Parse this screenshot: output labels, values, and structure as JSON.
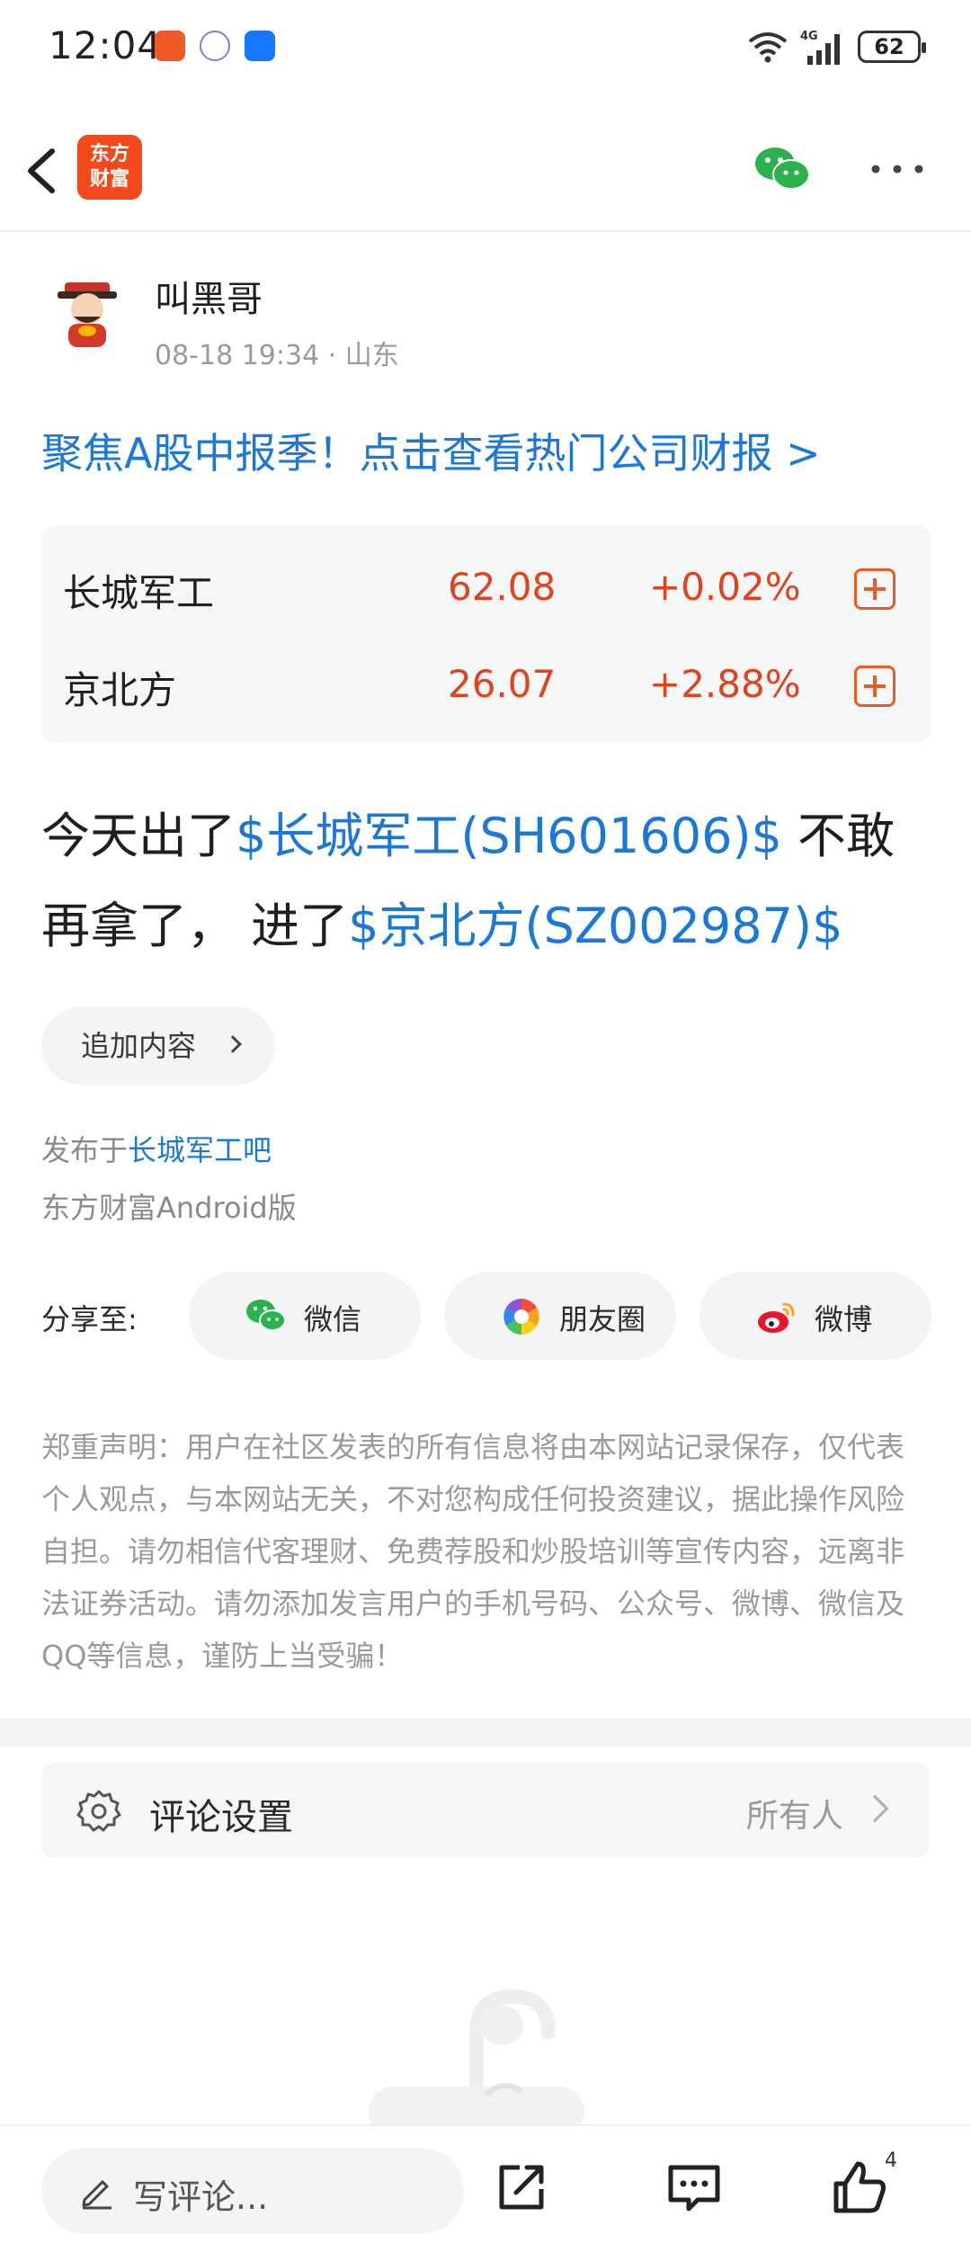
{
  "status_bar": {
    "time": "12:04",
    "network": "4G",
    "battery": "62"
  },
  "nav": {
    "logo_text_line1": "东方",
    "logo_text_line2": "财富"
  },
  "author": {
    "name": "叫黑哥",
    "time": "08-18 19:34",
    "separator": " · ",
    "location": "山东"
  },
  "promo": {
    "text": "聚焦A股中报季！点击查看热门公司财报 >"
  },
  "stocks": [
    {
      "name": "长城军工",
      "price": "62.08",
      "change": "+0.02%"
    },
    {
      "name": "京北方",
      "price": "26.07",
      "change": "+2.88%"
    }
  ],
  "post": {
    "part1": "今天出了",
    "link1": "$长城军工(SH601606)$",
    "part2": " 不敢再拿了， 进了",
    "link2": "$京北方(SZ002987)$"
  },
  "more_content_label": "追加内容",
  "published": {
    "prefix": "发布于",
    "bar": "长城军工吧",
    "client": "东方财富Android版"
  },
  "share": {
    "label": "分享至:",
    "wechat": "微信",
    "moments": "朋友圈",
    "weibo": "微博"
  },
  "disclaimer": "郑重声明：用户在社区发表的所有信息将由本网站记录保存，仅代表个人观点，与本网站无关，不对您构成任何投资建议，据此操作风险自担。请勿相信代客理财、免费荐股和炒股培训等宣传内容，远离非法证券活动。请勿添加发言用户的手机号码、公众号、微博、微信及QQ等信息，谨防上当受骗！",
  "comment_settings": {
    "label": "评论设置",
    "value": "所有人"
  },
  "bottom_bar": {
    "comment_placeholder": "写评论...",
    "like_count": "4"
  },
  "colors": {
    "link_blue": "#1b78d6",
    "price_red": "#e0431d",
    "brand_orange": "#f24a1d"
  }
}
